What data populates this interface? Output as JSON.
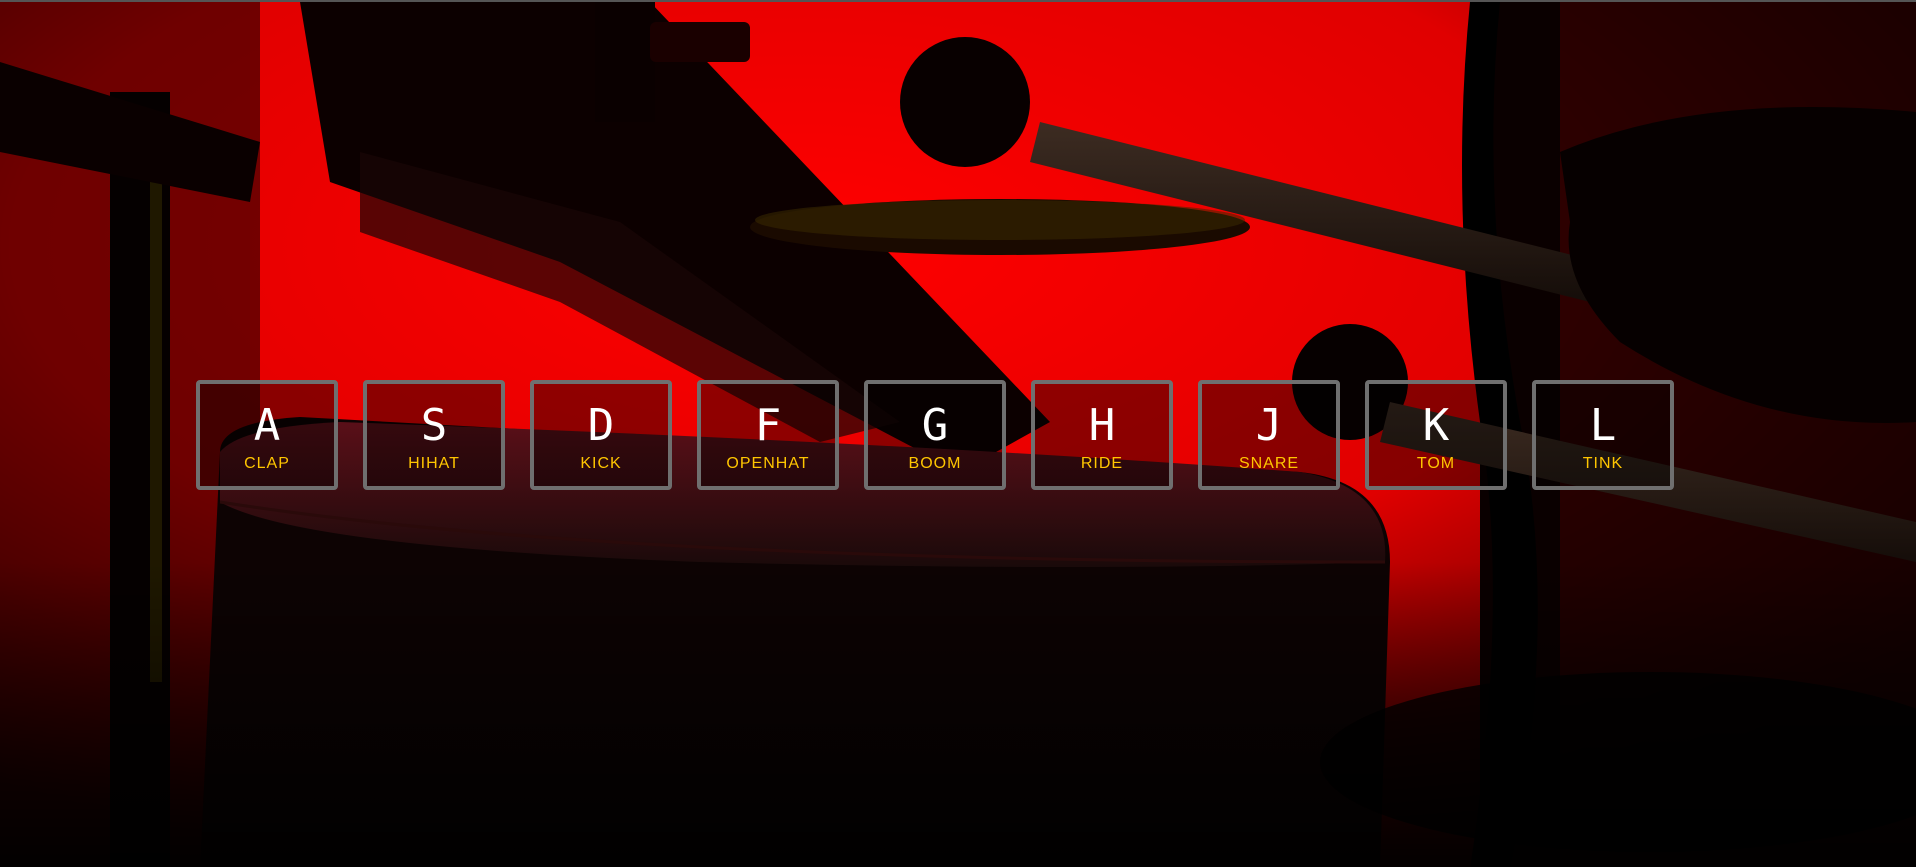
{
  "keys": [
    {
      "letter": "A",
      "sound": "CLAP"
    },
    {
      "letter": "S",
      "sound": "HIHAT"
    },
    {
      "letter": "D",
      "sound": "KICK"
    },
    {
      "letter": "F",
      "sound": "OPENHAT"
    },
    {
      "letter": "G",
      "sound": "BOOM"
    },
    {
      "letter": "H",
      "sound": "RIDE"
    },
    {
      "letter": "J",
      "sound": "SNARE"
    },
    {
      "letter": "K",
      "sound": "TOM"
    },
    {
      "letter": "L",
      "sound": "TINK"
    }
  ],
  "colors": {
    "background_red": "#ff0000",
    "key_border": "#6f6f6f",
    "key_letter": "#ffffff",
    "key_sound": "#ffc600"
  }
}
